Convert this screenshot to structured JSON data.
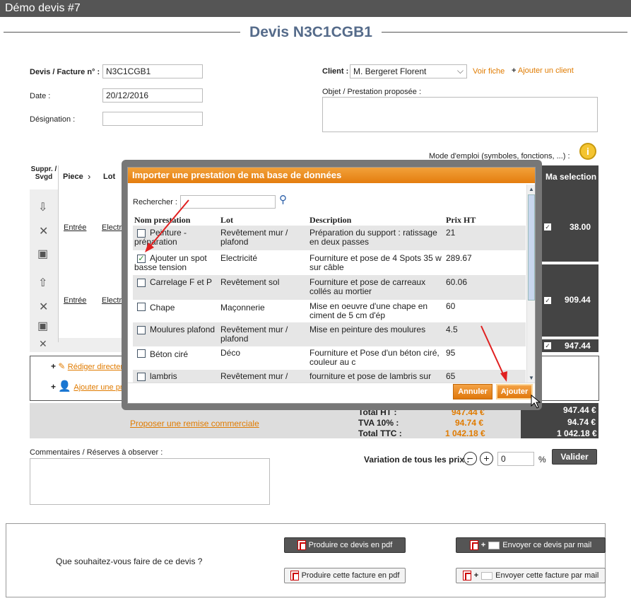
{
  "app_title": "Démo devis #7",
  "page_title": "Devis N3C1CGB1",
  "form": {
    "devis_label": "Devis / Facture n° :",
    "devis_value": "N3C1CGB1",
    "date_label": "Date :",
    "date_value": "20/12/2016",
    "designation_label": "Désignation :",
    "designation_value": "",
    "client_label": "Client :",
    "client_value": "M. Bergeret Florent",
    "voir_fiche": "Voir fiche",
    "ajouter_client": "Ajouter un client",
    "objet_label": "Objet / Prestation proposée :"
  },
  "mode_emploi": "Mode d'emploi (symboles, fonctions, ...) :",
  "table": {
    "col_suppr": "Suppr. / Svgd",
    "col_piece": "Piece",
    "col_lot": "Lot",
    "col_selection": "Ma selection",
    "rows": [
      {
        "piece": "Entrée",
        "lot": "Electricité",
        "value": "38.00"
      },
      {
        "piece": "Entrée",
        "lot": "Electricité",
        "value": "909.44"
      }
    ],
    "total_row": "947.44"
  },
  "add": {
    "rediger": "Rédiger directement",
    "ajouter": "Ajouter une prestation"
  },
  "totals": {
    "ht_label": "Total HT :",
    "ht_value": "947.44 €",
    "ht_right": "947.44 €",
    "tva_label": "TVA 10% :",
    "tva_value": "94.74 €",
    "tva_right": "94.74 €",
    "ttc_label": "Total TTC :",
    "ttc_value": "1 042.18 €",
    "ttc_right": "1 042.18 €",
    "remise": "Proposer une remise commerciale"
  },
  "comments_label": "Commentaires / Réserves à observer :",
  "variation": {
    "label": "Variation de tous les prix :",
    "value": "0",
    "unit": "%",
    "valider": "Valider"
  },
  "actions": {
    "question": "Que souhaitez-vous faire de ce devis ?",
    "pdf_devis": "Produire ce devis en pdf",
    "mail_devis": "Envoyer ce devis par mail",
    "pdf_facture": "Produire cette facture en pdf",
    "mail_facture": "Envoyer cette facture par mail"
  },
  "modal": {
    "title": "Importer une prestation de ma base de données",
    "search_label": "Rechercher :",
    "headers": {
      "nom": "Nom prestation",
      "lot": "Lot",
      "desc": "Description",
      "prix": "Prix HT"
    },
    "rows": [
      {
        "checked": false,
        "nom": "Peinture - préparation",
        "lot": "Revêtement mur / plafond",
        "desc": "Préparation du support : ratissage en deux passes",
        "prix": "21"
      },
      {
        "checked": true,
        "nom": "Ajouter un spot basse tension",
        "lot": "Electricité",
        "desc": "Fourniture et pose de 4 Spots 35 w sur câble",
        "prix": "289.67"
      },
      {
        "checked": false,
        "nom": "Carrelage F et P",
        "lot": "Revêtement sol",
        "desc": "Fourniture et pose de carreaux collés au mortier",
        "prix": "60.06"
      },
      {
        "checked": false,
        "nom": "Chape",
        "lot": "Maçonnerie",
        "desc": "Mise en oeuvre d'une chape en ciment de 5 cm d'ép",
        "prix": "60"
      },
      {
        "checked": false,
        "nom": "Moulures plafond",
        "lot": "Revêtement mur / plafond",
        "desc": "Mise en peinture des moulures",
        "prix": "4.5"
      },
      {
        "checked": false,
        "nom": "Béton ciré",
        "lot": "Déco",
        "desc": "Fourniture et Pose d'un béton ciré, couleur au c",
        "prix": "95"
      },
      {
        "checked": false,
        "nom": "lambris",
        "lot": "Revêtement mur /",
        "desc": "fourniture et pose de lambris sur",
        "prix": "65"
      }
    ],
    "annuler": "Annuler",
    "ajouter": "Ajouter"
  },
  "colors": {
    "orange": "#e07b00",
    "dark": "#444444",
    "title": "#556b8a",
    "annotation": "#e02020"
  }
}
